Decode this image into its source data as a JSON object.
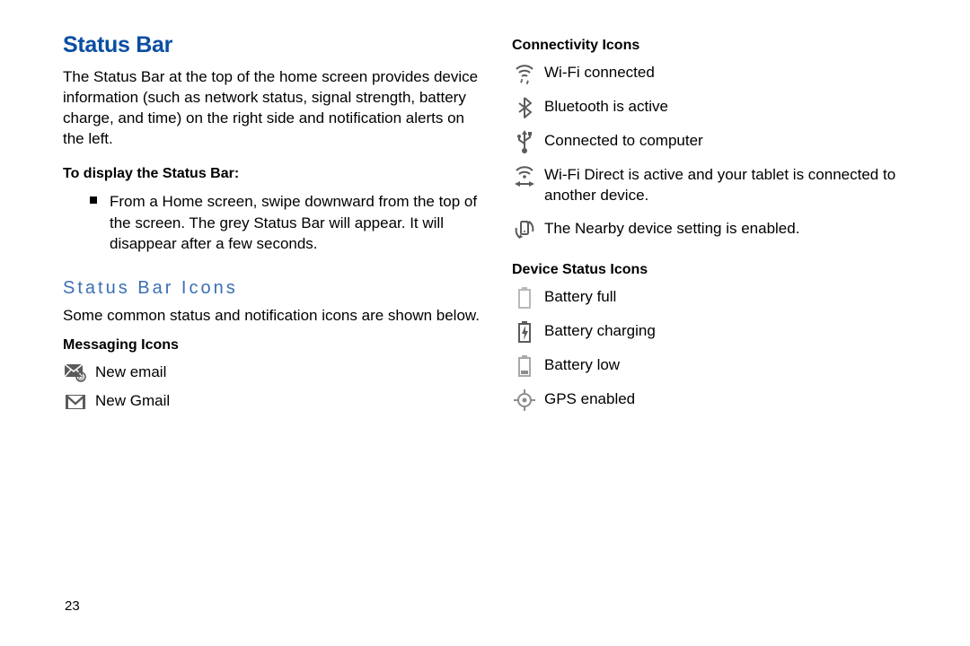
{
  "left": {
    "title": "Status Bar",
    "intro": "The Status Bar at the top of the home screen provides device information (such as network status, signal strength, battery charge, and time) on the right side and notification alerts on the left.",
    "display_header": "To display the Status Bar:",
    "display_bullet": "From a Home screen, swipe downward from the top of the screen. The grey Status Bar will appear. It will disappear after a few seconds.",
    "icons_header": "Status Bar Icons",
    "icons_intro": "Some common status and notification icons are shown below.",
    "messaging_header": "Messaging Icons",
    "messaging": {
      "new_email": "New email",
      "new_gmail": "New Gmail"
    }
  },
  "right": {
    "connectivity_header": "Connectivity Icons",
    "connectivity": {
      "wifi": "Wi-Fi connected",
      "bluetooth": "Bluetooth is active",
      "usb": "Connected to computer",
      "wifi_direct": "Wi-Fi Direct is active and your tablet is connected to another device.",
      "nearby": "The Nearby device setting is enabled."
    },
    "device_header": "Device Status Icons",
    "device": {
      "battery_full": "Battery full",
      "battery_charging": "Battery charging",
      "battery_low": "Battery low",
      "gps": "GPS enabled"
    }
  },
  "page_number": "23"
}
